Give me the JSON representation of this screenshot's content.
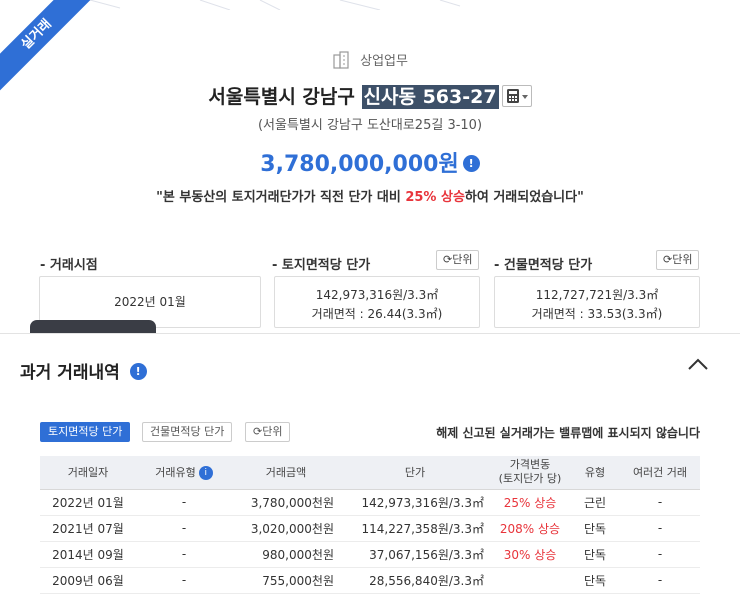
{
  "ribbon": "실거래",
  "property_type": "상업업무",
  "address": {
    "main": "서울특별시 강남구",
    "highlight": "신사동 563-27"
  },
  "road_address": "(서울특별시 강남구 도산대로25길 3-10)",
  "price": "3,780,000,000원",
  "summary": {
    "prefix": "\"본 부동산의 토지거래단가가 직전 단가 대비 ",
    "highlight": "25% 상승",
    "suffix": "하여 거래되었습니다\""
  },
  "metrics": {
    "date": {
      "label": "- 거래시점",
      "value": "2022년 01월"
    },
    "land": {
      "label": "- 토지면적당 단가",
      "unit_button": "단위",
      "value": "142,973,316원/3.3㎡",
      "area": "거래면적 : 26.44(3.3㎡)"
    },
    "building": {
      "label": "- 건물면적당 단가",
      "unit_button": "단위",
      "value": "112,727,721원/3.3㎡",
      "area": "거래면적 : 33.53(3.3㎡)"
    }
  },
  "history": {
    "title": "과거 거래내역",
    "tabs": [
      "토지면적당 단가",
      "건물면적당 단가"
    ],
    "unit_button": "단위",
    "notice": "해제 신고된 실거래가는 밸류맵에 표시되지 않습니다",
    "headers": {
      "date": "거래일자",
      "type": "거래유형",
      "amount": "거래금액",
      "unit_price": "단가",
      "change_l1": "가격변동",
      "change_l2": "(토지단가 당)",
      "kind": "유형",
      "multi": "여러건 거래"
    },
    "rows": [
      {
        "date": "2022년 01월",
        "type": "-",
        "amount": "3,780,000천원",
        "unit_price": "142,973,316원/3.3㎡",
        "change": "25% 상승",
        "kind": "근린",
        "multi": "-"
      },
      {
        "date": "2021년 07월",
        "type": "-",
        "amount": "3,020,000천원",
        "unit_price": "114,227,358원/3.3㎡",
        "change": "208% 상승",
        "kind": "단독",
        "multi": "-"
      },
      {
        "date": "2014년 09월",
        "type": "-",
        "amount": "980,000천원",
        "unit_price": "37,067,156원/3.3㎡",
        "change": "30% 상승",
        "kind": "단독",
        "multi": "-"
      },
      {
        "date": "2009년 06월",
        "type": "-",
        "amount": "755,000천원",
        "unit_price": "28,556,840원/3.3㎡",
        "change": "",
        "kind": "단독",
        "multi": "-"
      }
    ]
  },
  "colors": {
    "accent": "#2f6fd6",
    "up": "#e8343b",
    "highlight_bg": "#3d5068"
  },
  "icons": [
    "building-icon",
    "calculator-icon",
    "info-icon",
    "refresh-icon",
    "chevron-up-icon"
  ]
}
